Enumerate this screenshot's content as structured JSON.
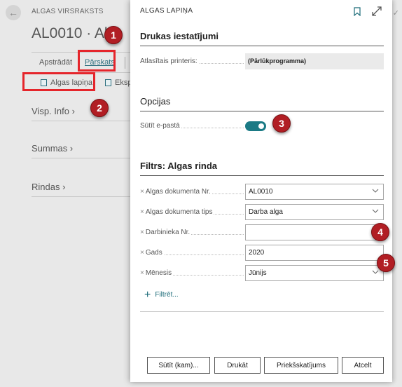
{
  "background": {
    "caption": "ALGAS VIRSRAKSTS",
    "title": "AL0010 · Al",
    "menu": {
      "process": "Apstrādāt",
      "reports": "Pārskats"
    },
    "actions": {
      "payslip": "Algas lapiņa",
      "export": "Ekspo"
    },
    "sections": {
      "general": "Visp. Info",
      "totals": "Summas",
      "lines": "Rindas"
    },
    "right_text": "as"
  },
  "dialog": {
    "caption": "ALGAS LAPIŅA",
    "print_settings": {
      "heading": "Drukas iestatījumi",
      "printer_label": "Atlasītais printeris:",
      "printer_value": "(Pārlūkprogramma)"
    },
    "options": {
      "heading": "Opcijas",
      "send_email_label": "Sūtīt e-pastā",
      "send_email_on": true
    },
    "filters": {
      "heading": "Filtrs: Algas rinda",
      "fields": [
        {
          "label": "Algas dokumenta Nr.",
          "value": "AL0010",
          "has_dropdown": true
        },
        {
          "label": "Algas dokumenta tips",
          "value": "Darba alga",
          "has_dropdown": true
        },
        {
          "label": "Darbinieka Nr.",
          "value": "",
          "has_dropdown": false
        },
        {
          "label": "Gads",
          "value": "2020",
          "has_dropdown": false
        },
        {
          "label": "Mēnesis",
          "value": "Jūnijs",
          "has_dropdown": true
        }
      ],
      "add_filter": "Filtrēt..."
    },
    "buttons": {
      "send": "Sūtīt (kam)...",
      "print": "Drukāt",
      "preview": "Priekšskatījums",
      "cancel": "Atcelt"
    }
  },
  "callouts": [
    "1",
    "2",
    "3",
    "4",
    "5"
  ],
  "colors": {
    "accent": "#1b7a85",
    "callout": "#b11e24",
    "highlight": "#e5252b"
  }
}
